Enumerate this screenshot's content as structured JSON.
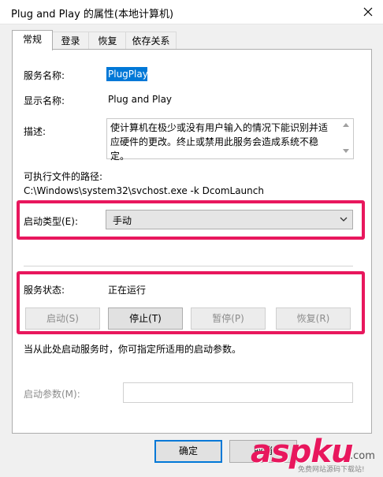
{
  "window": {
    "title": "Plug and Play 的属性(本地计算机)"
  },
  "tabs": [
    {
      "label": "常规"
    },
    {
      "label": "登录"
    },
    {
      "label": "恢复"
    },
    {
      "label": "依存关系"
    }
  ],
  "general": {
    "service_name_label": "服务名称:",
    "service_name_value": "PlugPlay",
    "display_name_label": "显示名称:",
    "display_name_value": "Plug and Play",
    "description_label": "描述:",
    "description_value": "使计算机在极少或没有用户输入的情况下能识别并适应硬件的更改。终止或禁用此服务会造成系统不稳定。",
    "exe_path_label": "可执行文件的路径:",
    "exe_path_value": "C:\\Windows\\system32\\svchost.exe -k DcomLaunch",
    "startup_type_label": "启动类型(E):",
    "startup_type_value": "手动",
    "service_status_label": "服务状态:",
    "service_status_value": "正在运行",
    "start_button": "启动(S)",
    "stop_button": "停止(T)",
    "pause_button": "暂停(P)",
    "resume_button": "恢复(R)",
    "hint_text": "当从此处启动服务时，你可指定所适用的启动参数。",
    "start_params_label": "启动参数(M):",
    "start_params_value": ""
  },
  "footer": {
    "ok_button": "确定",
    "cancel_button": "取消"
  },
  "watermark": {
    "logo": "aspku",
    "suffix": ".com",
    "subtitle": "免费网站源码下载站!"
  },
  "colors": {
    "highlight": "#e8175d",
    "accent": "#0078d7"
  }
}
